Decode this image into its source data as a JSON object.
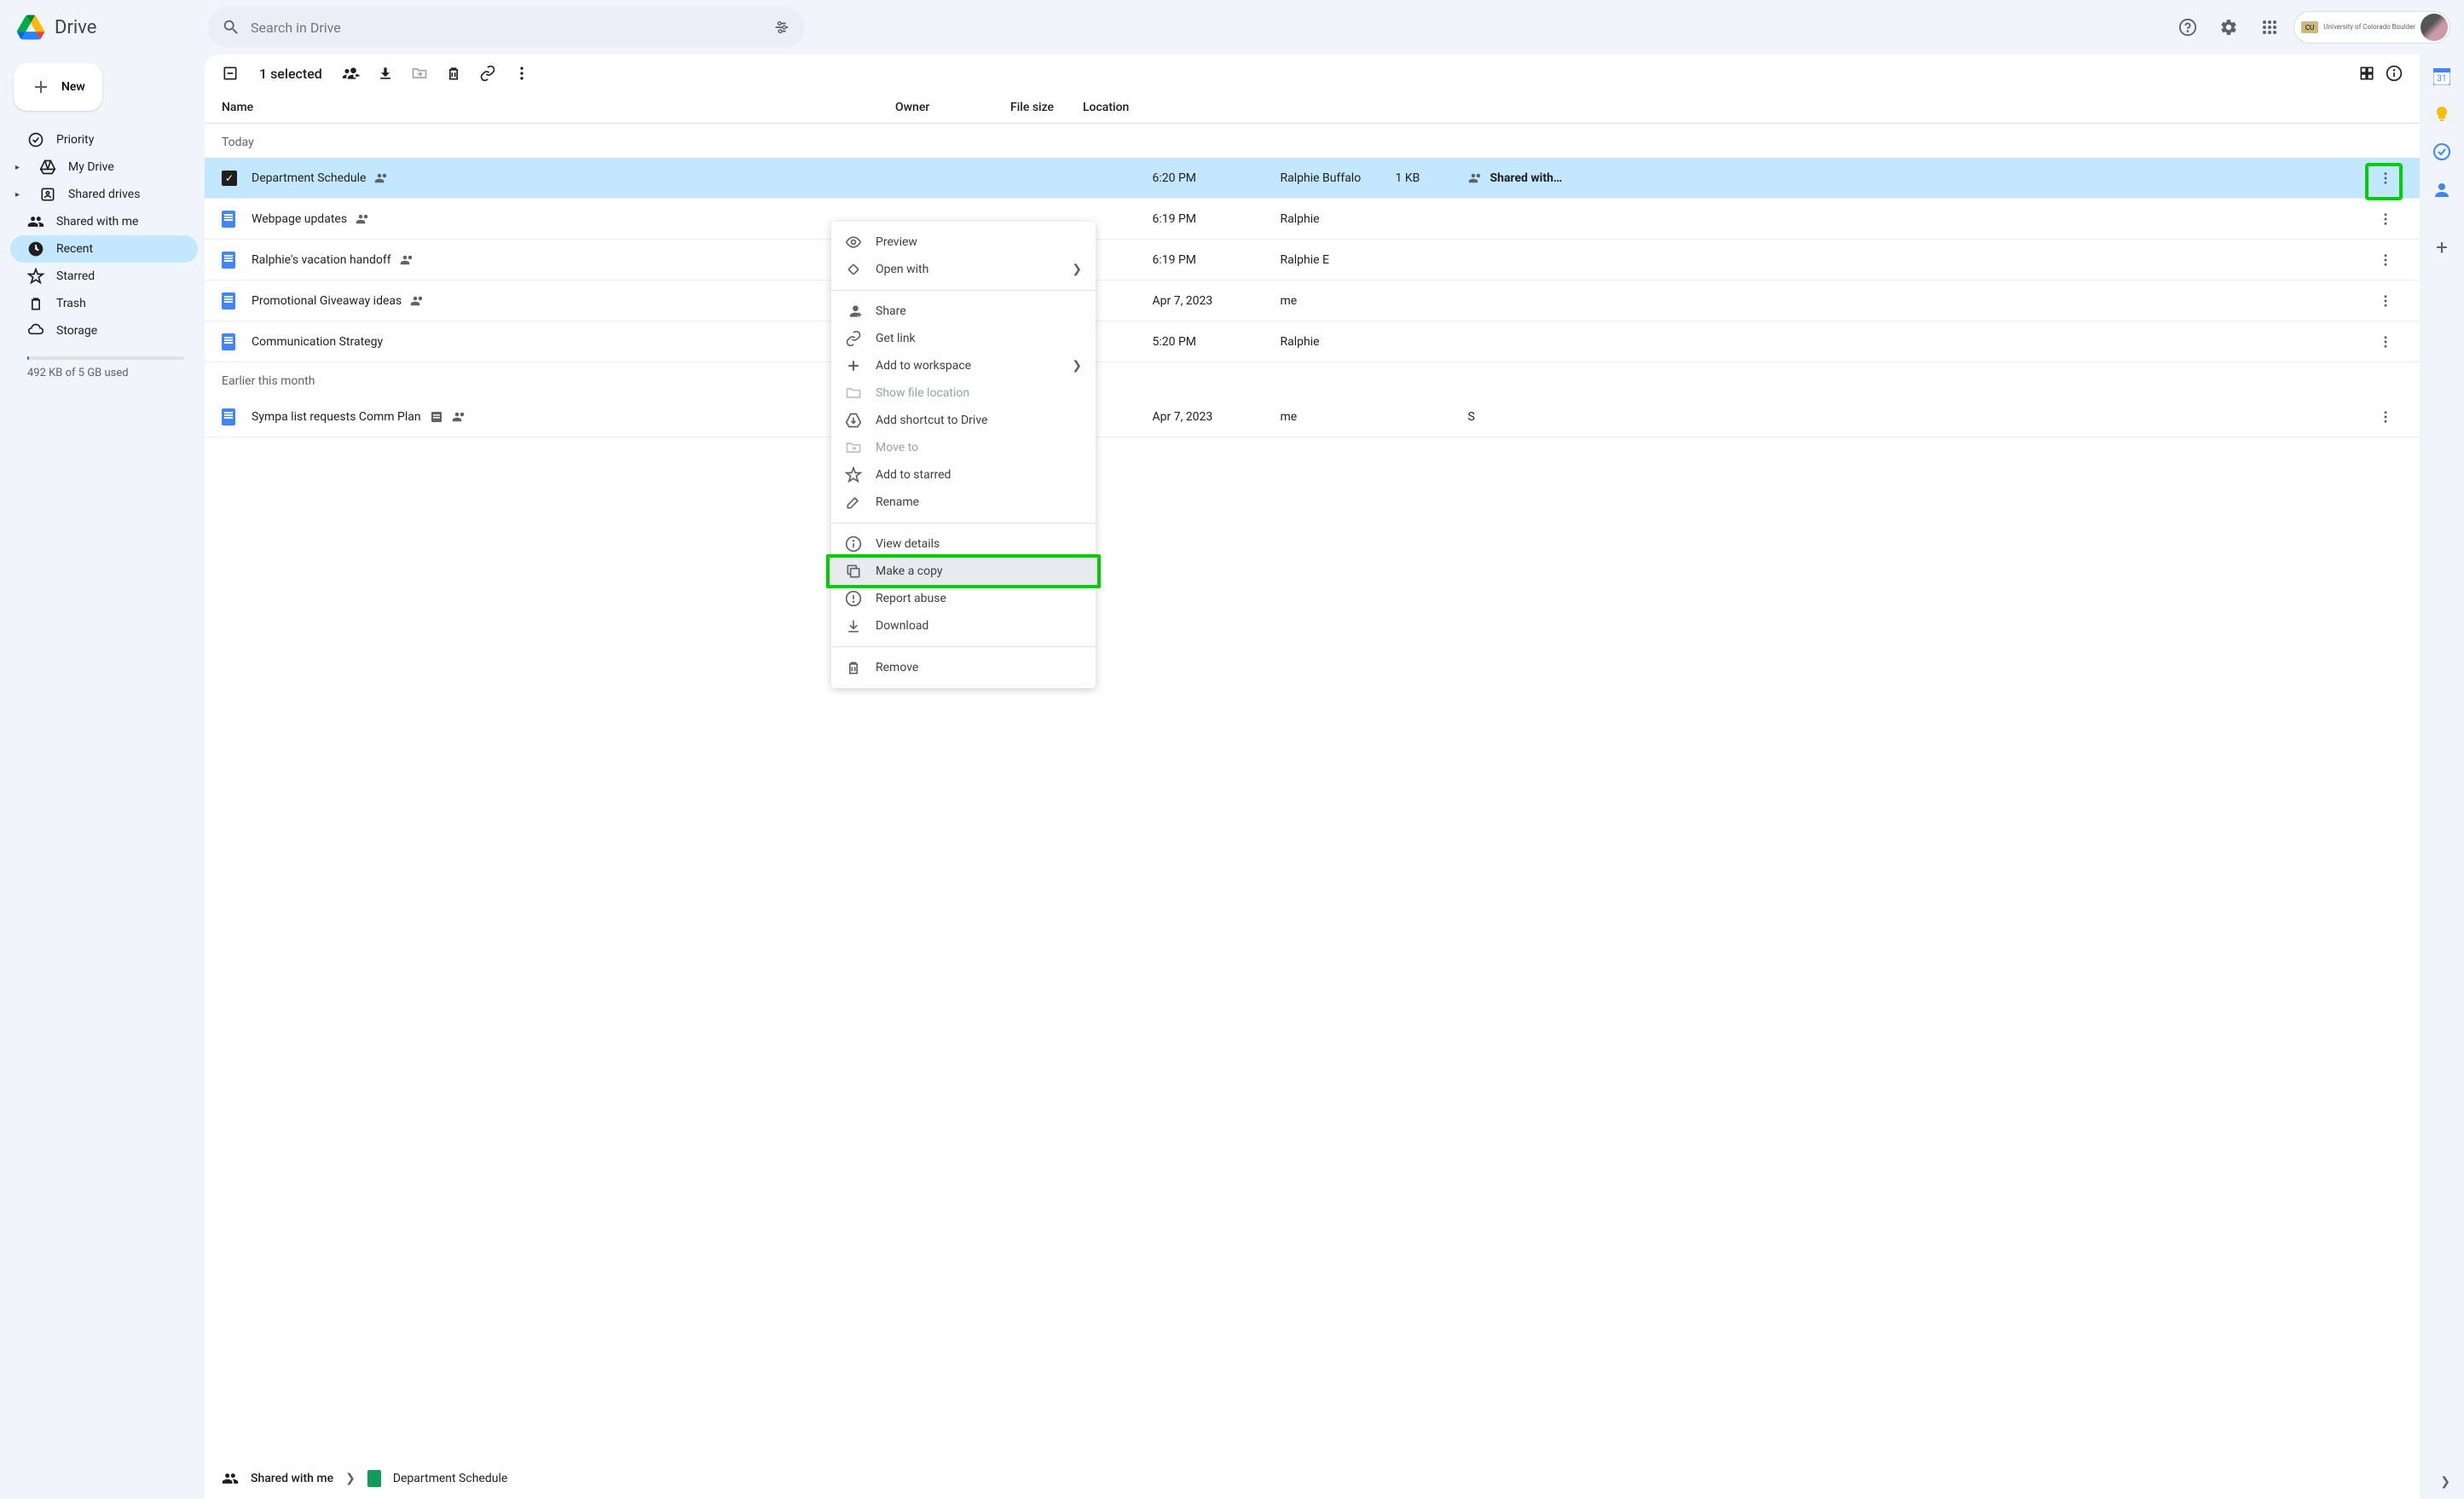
{
  "app": {
    "name": "Drive",
    "org": "University of Colorado Boulder"
  },
  "search": {
    "placeholder": "Search in Drive"
  },
  "newButton": "New",
  "sidebar": {
    "items": [
      {
        "label": "Priority",
        "icon": "priority"
      },
      {
        "label": "My Drive",
        "icon": "mydrive",
        "expandable": true
      },
      {
        "label": "Shared drives",
        "icon": "shareddrives",
        "expandable": true
      },
      {
        "label": "Shared with me",
        "icon": "sharedwithme"
      },
      {
        "label": "Recent",
        "icon": "recent",
        "active": true
      },
      {
        "label": "Starred",
        "icon": "starred"
      },
      {
        "label": "Trash",
        "icon": "trash"
      },
      {
        "label": "Storage",
        "icon": "storage"
      }
    ],
    "storageText": "492 KB of 5 GB used"
  },
  "toolbar": {
    "selected": "1 selected"
  },
  "columns": {
    "name": "Name",
    "owner": "Owner",
    "size": "File size",
    "location": "Location"
  },
  "sections": [
    {
      "label": "Today",
      "files": [
        {
          "name": "Department Schedule",
          "shared": true,
          "time": "6:20 PM",
          "owner": "Ralphie Buffalo",
          "size": "1 KB",
          "location": "Shared with…",
          "selected": true,
          "icon": "sheet"
        },
        {
          "name": "Webpage updates",
          "shared": true,
          "time": "6:19 PM",
          "owner": "Ralphie",
          "size": "",
          "location": "",
          "icon": "doc"
        },
        {
          "name": "Ralphie's vacation handoff",
          "shared": true,
          "time": "6:19 PM",
          "owner": "Ralphie E",
          "size": "",
          "location": "",
          "icon": "doc"
        },
        {
          "name": "Promotional Giveaway ideas",
          "shared": true,
          "time": "Apr 7, 2023",
          "owner": "me",
          "size": "",
          "location": "",
          "icon": "doc"
        },
        {
          "name": "Communication Strategy",
          "shared": false,
          "time": "5:20 PM",
          "owner": "Ralphie",
          "size": "",
          "location": "",
          "icon": "doc"
        }
      ]
    },
    {
      "label": "Earlier this month",
      "files": [
        {
          "name": "Sympa list requests Comm Plan",
          "shared": true,
          "hasExtra": true,
          "time": "Apr 7, 2023",
          "owner": "me",
          "size": "",
          "location": "S",
          "icon": "doc"
        }
      ]
    }
  ],
  "contextMenu": {
    "items": [
      {
        "label": "Preview",
        "icon": "eye"
      },
      {
        "label": "Open with",
        "icon": "openwith",
        "arrow": true
      },
      {
        "sep": true
      },
      {
        "label": "Share",
        "icon": "share"
      },
      {
        "label": "Get link",
        "icon": "link"
      },
      {
        "label": "Add to workspace",
        "icon": "plus",
        "arrow": true
      },
      {
        "label": "Show file location",
        "icon": "folder",
        "disabled": true
      },
      {
        "label": "Add shortcut to Drive",
        "icon": "shortcut"
      },
      {
        "label": "Move to",
        "icon": "moveto",
        "disabled": true
      },
      {
        "label": "Add to starred",
        "icon": "star"
      },
      {
        "label": "Rename",
        "icon": "rename"
      },
      {
        "sep": true
      },
      {
        "label": "View details",
        "icon": "info"
      },
      {
        "label": "Make a copy",
        "icon": "copy",
        "highlighted": true
      },
      {
        "label": "Report abuse",
        "icon": "report"
      },
      {
        "label": "Download",
        "icon": "download"
      },
      {
        "sep": true
      },
      {
        "label": "Remove",
        "icon": "trash"
      }
    ]
  },
  "breadcrumb": {
    "context": "Shared with me",
    "file": "Department Schedule"
  },
  "annotations": {
    "highlightedMoreButton": true,
    "highlightedMenuItem": "Make a copy"
  }
}
